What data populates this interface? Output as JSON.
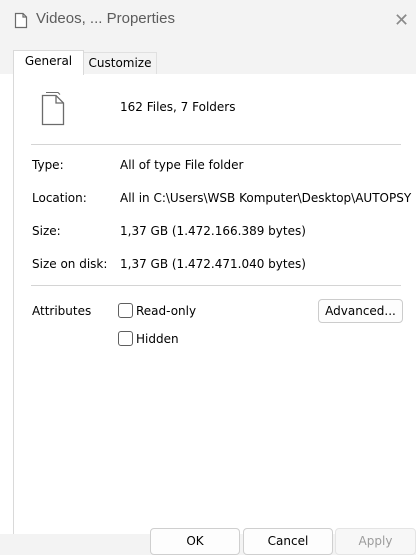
{
  "window": {
    "title": "Videos, ... Properties",
    "close_glyph": "✕"
  },
  "tabs": [
    {
      "label": "General",
      "active": true
    },
    {
      "label": "Customize",
      "active": false
    }
  ],
  "general": {
    "summary": "162 Files, 7 Folders",
    "fields": [
      {
        "label": "Type:",
        "value": "All of type File folder"
      },
      {
        "label": "Location:",
        "value": "All in C:\\Users\\WSB Komputer\\Desktop\\AUTOPSY"
      },
      {
        "label": "Size:",
        "value": "1,37 GB (1.472.166.389 bytes)"
      },
      {
        "label": "Size on disk:",
        "value": "1,37 GB (1.472.471.040 bytes)"
      }
    ],
    "attributes": {
      "label": "Attributes",
      "read_only": {
        "label": "Read-only",
        "checked": false
      },
      "hidden": {
        "label": "Hidden",
        "checked": false
      },
      "advanced_label": "Advanced..."
    }
  },
  "footer": {
    "ok_label": "OK",
    "cancel_label": "Cancel",
    "apply_label": "Apply"
  },
  "colors": {
    "chrome_bg": "#f3f3f3",
    "disabled_text": "#9c9c9c"
  }
}
